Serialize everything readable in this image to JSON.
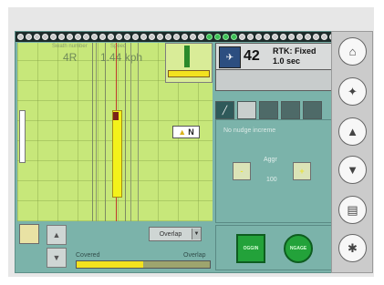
{
  "map": {
    "swath_label": "Swath number",
    "swath_value": "4R",
    "speed_label": "Speed",
    "speed_value": "1.44 kph",
    "direction_letter": "N"
  },
  "gps": {
    "satellite_count": "42",
    "status": "RTK: Fixed",
    "age": "1.0 sec"
  },
  "nudge": {
    "message": "No nudge increme",
    "aggr_label": "Aggr",
    "aggr_value": "100",
    "minus": "-",
    "plus": "+"
  },
  "coverage": {
    "mode_select": "Overlap",
    "covered_label": "Covered",
    "overlap_label": "Overlap",
    "covered_fraction": 0.5
  },
  "controls": {
    "green_left": "OGGIN",
    "green_right": "NGAGE"
  },
  "side_icons": [
    "home-icon",
    "wrench-icon",
    "up-arrow-icon",
    "down-arrow-icon",
    "book-icon",
    "runner-icon"
  ],
  "colors": {
    "screen_bg": "#7bb3aa",
    "map_bg": "#c7e77a",
    "swath": "#f3f21a",
    "engage_green": "#23a23a",
    "track_dark": "#1d2b2a"
  }
}
